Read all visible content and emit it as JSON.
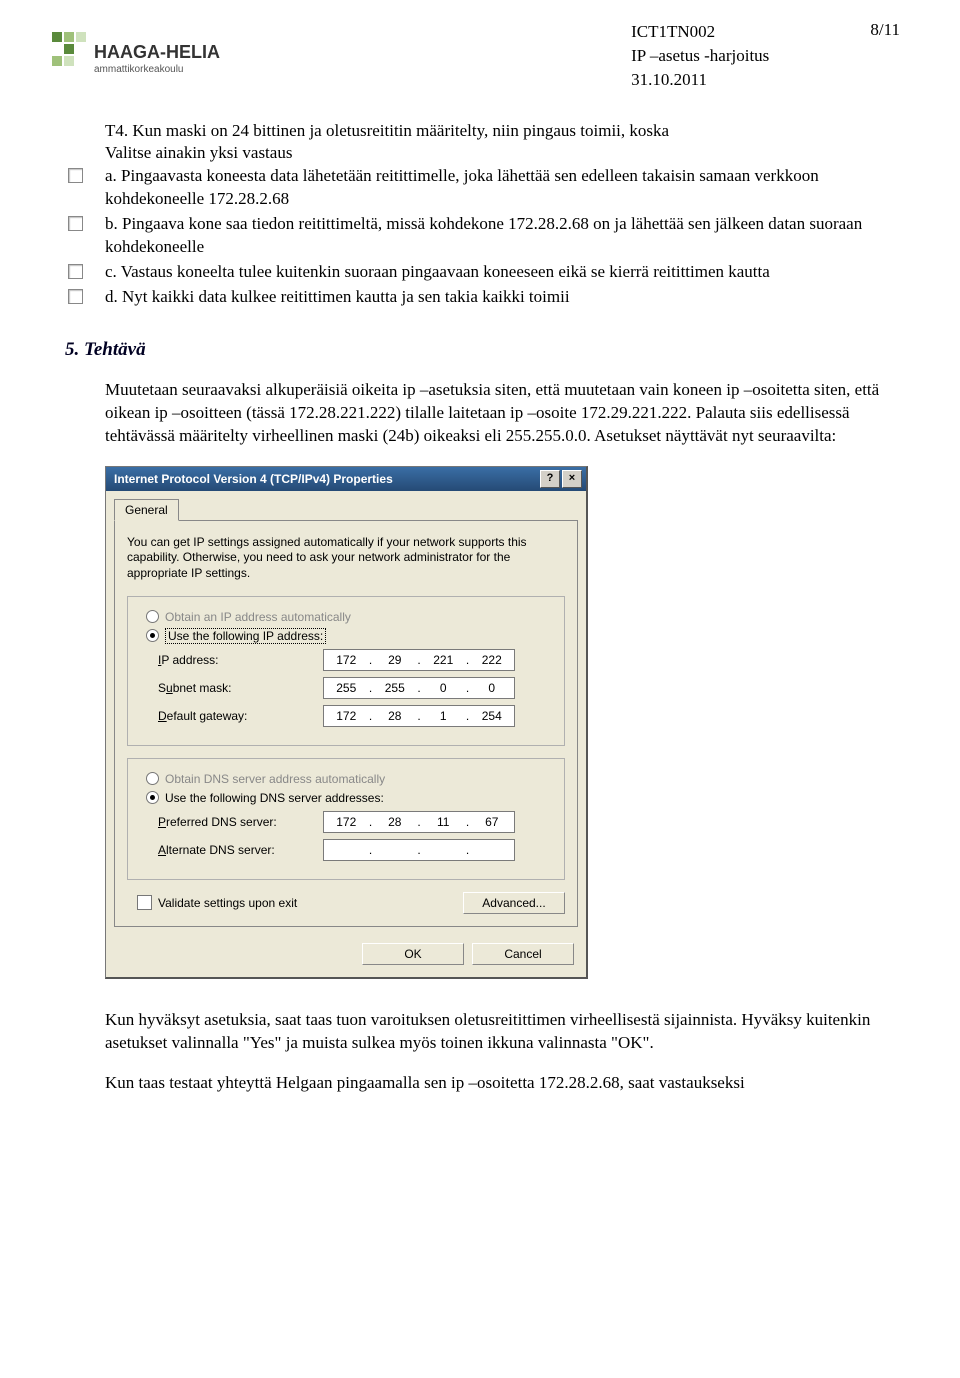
{
  "header": {
    "logo_top": "HAAGA-HELIA",
    "logo_sub": "ammattikorkeakoulu",
    "code": "ICT1TN002",
    "subtitle": "IP –asetus -harjoitus",
    "date": "31.10.2011",
    "pagenum": "8/11"
  },
  "question": {
    "stem": "T4. Kun maski on 24 bittinen ja oletusreititin määritelty, niin pingaus toimii, koska",
    "instr": "Valitse ainakin yksi vastaus",
    "choices": [
      "a. Pingaavasta koneesta data lähetetään reitittimelle, joka lähettää sen edelleen takaisin samaan verkkoon kohdekoneelle 172.28.2.68",
      "b. Pingaava kone saa tiedon reitittimeltä, missä kohdekone 172.28.2.68 on ja lähettää sen jälkeen datan suoraan kohdekoneelle",
      "c. Vastaus koneelta tulee kuitenkin suoraan pingaavaan koneeseen eikä se kierrä reitittimen kautta",
      "d. Nyt kaikki data kulkee reitittimen kautta ja sen takia kaikki toimii"
    ]
  },
  "task": {
    "heading": "5. Tehtävä",
    "para1": "Muutetaan seuraavaksi alkuperäisiä oikeita ip –asetuksia siten, että muutetaan vain koneen ip –osoitetta siten, että oikean ip –osoitteen (tässä 172.28.221.222) tilalle laitetaan ip –osoite 172.29.221.222. Palauta siis edellisessä tehtävässä määritelty virheellinen maski (24b) oikeaksi eli 255.255.0.0. Asetukset näyttävät nyt seuraavilta:",
    "para2": "Kun hyväksyt asetuksia, saat taas tuon varoituksen oletusreitittimen virheellisestä sijainnista. Hyväksy kuitenkin asetukset valinnalla \"Yes\" ja muista sulkea myös toinen ikkuna valinnasta \"OK\".",
    "para3": "Kun taas testaat yhteyttä Helgaan pingaamalla sen ip –osoitetta 172.28.2.68, saat vastaukseksi"
  },
  "dialog": {
    "title": "Internet Protocol Version 4 (TCP/IPv4) Properties",
    "btn_help": "?",
    "btn_close": "×",
    "tab": "General",
    "info": "You can get IP settings assigned automatically if your network supports this capability. Otherwise, you need to ask your network administrator for the appropriate IP settings.",
    "radio_obtain_ip": "Obtain an IP address automatically",
    "radio_use_ip": "Use the following IP address:",
    "label_ip": "IP address:",
    "label_mask": "Subnet mask:",
    "label_gw": "Default gateway:",
    "ip": [
      "172",
      "29",
      "221",
      "222"
    ],
    "mask": [
      "255",
      "255",
      "0",
      "0"
    ],
    "gw": [
      "172",
      "28",
      "1",
      "254"
    ],
    "radio_obtain_dns": "Obtain DNS server address automatically",
    "radio_use_dns": "Use the following DNS server addresses:",
    "label_pdns": "Preferred DNS server:",
    "label_adns": "Alternate DNS server:",
    "pdns": [
      "172",
      "28",
      "11",
      "67"
    ],
    "adns": [
      "",
      "",
      "",
      ""
    ],
    "chk_validate": "Validate settings upon exit",
    "btn_advanced": "Advanced...",
    "btn_ok": "OK",
    "btn_cancel": "Cancel"
  }
}
